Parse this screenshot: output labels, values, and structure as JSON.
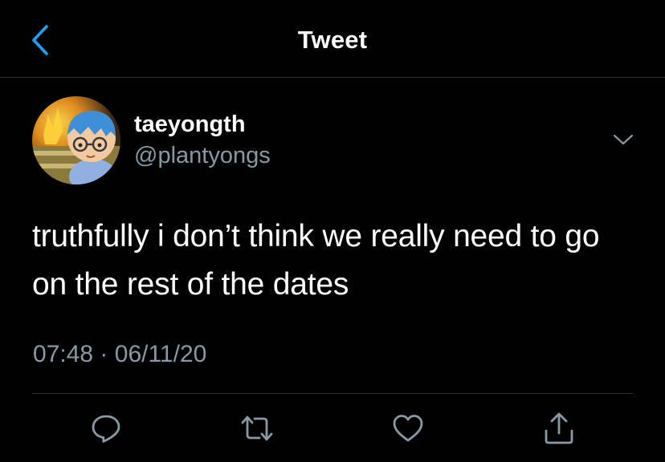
{
  "header": {
    "title": "Tweet",
    "back_icon": "chevron-left-icon"
  },
  "tweet": {
    "author": {
      "display_name": "taeyongth",
      "handle": "@plantyongs",
      "avatar_icon": "avatar-image"
    },
    "menu_icon": "chevron-down-icon",
    "text": "truthfully i don’t think we really need to go on the rest of the dates",
    "time": "07:48",
    "separator": "·",
    "date": "06/11/20"
  },
  "actions": [
    {
      "name": "reply",
      "icon": "reply-icon"
    },
    {
      "name": "retweet",
      "icon": "retweet-icon"
    },
    {
      "name": "like",
      "icon": "heart-icon"
    },
    {
      "name": "share",
      "icon": "share-icon"
    }
  ],
  "colors": {
    "background": "#000000",
    "text": "#ffffff",
    "secondary_text": "#8899a6",
    "accent": "#1da1f2",
    "divider": "#2f3336"
  }
}
